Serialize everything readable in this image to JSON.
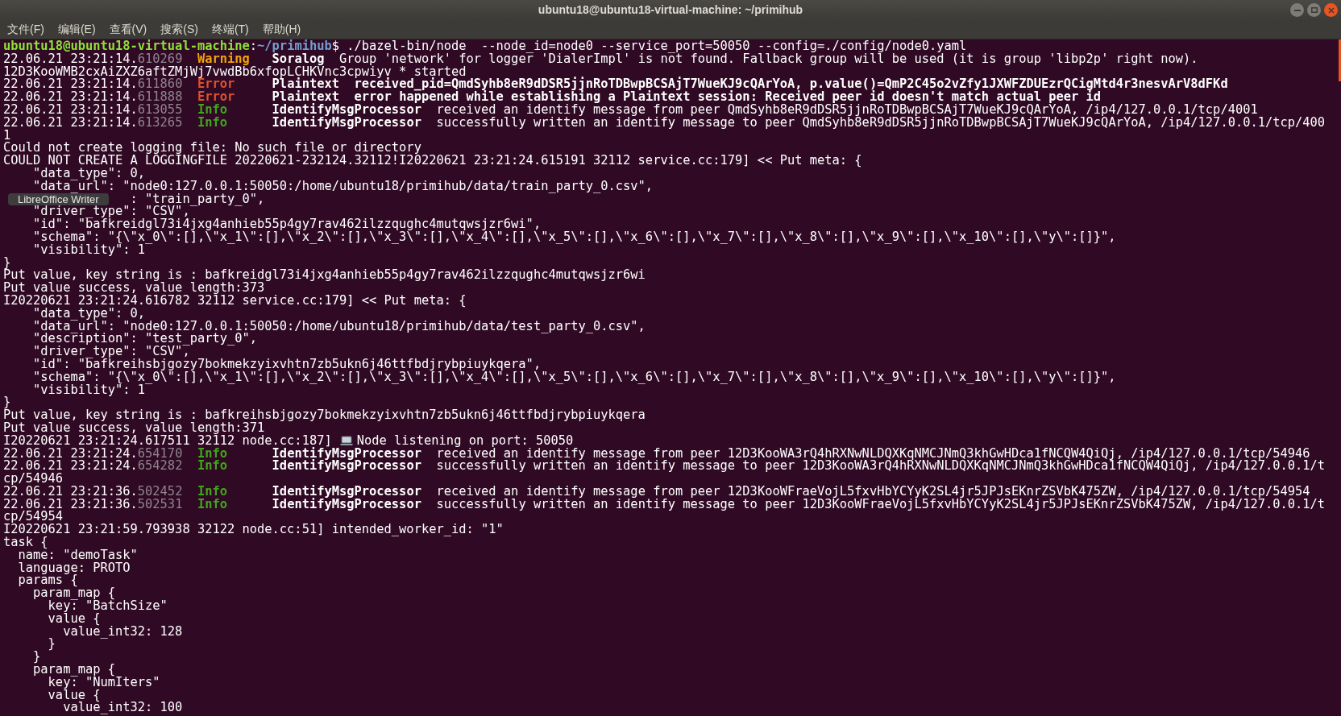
{
  "window": {
    "title": "ubuntu18@ubuntu18-virtual-machine: ~/primihub"
  },
  "menu": [
    "文件(F)",
    "编辑(E)",
    "查看(V)",
    "搜索(S)",
    "终端(T)",
    "帮助(H)"
  ],
  "tooltip": "LibreOffice Writer",
  "lines": [
    {
      "kind": "prompt",
      "user_host": "ubuntu18@ubuntu18-virtual-machine",
      "separator": ":",
      "path": "~/primihub",
      "command": "$ ./bazel-bin/node  --node_id=node0 --service_port=50050 --config=./config/node0.yaml"
    },
    {
      "kind": "log",
      "time": "22.06.21 23:21:14.",
      "micros": "610269",
      "level": "Warning",
      "color": "#f0a30a",
      "source": "Soralog",
      "message": "Group 'network' for logger 'DialerImpl' is not found. Fallback group will be used (it is group 'libp2p' right now).",
      "bold_message": false
    },
    {
      "kind": "plain",
      "text": "12D3KooWMB2cxAiZXZ6aftZMjWj7vwdBb6xfopLCHKVnc3cpwiyv * started"
    },
    {
      "kind": "log",
      "time": "22.06.21 23:21:14.",
      "micros": "611860",
      "level": "Error",
      "color": "#e0502a",
      "source": "Plaintext",
      "message": "received_pid=QmdSyhb8eR9dDSR5jjnRoTDBwpBCSAjT7WueKJ9cQArYoA, p.value()=QmP2C45o2vZfy1JXWFZDUEzrQCigMtd4r3nesvArV8dFKd",
      "bold_message": true
    },
    {
      "kind": "log",
      "time": "22.06.21 23:21:14.",
      "micros": "611888",
      "level": "Error",
      "color": "#e0502a",
      "source": "Plaintext",
      "message": "error happened while establishing a Plaintext session: Received peer id doesn't match actual peer id",
      "bold_message": true
    },
    {
      "kind": "log",
      "time": "22.06.21 23:21:14.",
      "micros": "613055",
      "level": "Info",
      "color": "#3fa61a",
      "source": "IdentifyMsgProcessor",
      "message": "received an identify message from peer QmdSyhb8eR9dDSR5jjnRoTDBwpBCSAjT7WueKJ9cQArYoA, /ip4/127.0.0.1/tcp/4001",
      "bold_message": false
    },
    {
      "kind": "log",
      "time": "22.06.21 23:21:14.",
      "micros": "613265",
      "level": "Info",
      "color": "#3fa61a",
      "source": "IdentifyMsgProcessor",
      "message": "successfully written an identify message to peer QmdSyhb8eR9dDSR5jjnRoTDBwpBCSAjT7WueKJ9cQArYoA, /ip4/127.0.0.1/tcp/400",
      "bold_message": false
    },
    {
      "kind": "plain",
      "text": "1"
    },
    {
      "kind": "plain",
      "text": "Could not create logging file: No such file or directory"
    },
    {
      "kind": "plain",
      "text": "COULD NOT CREATE A LOGGINGFILE 20220621-232124.32112!I20220621 23:21:24.615191 32112 service.cc:179] << Put meta: {"
    },
    {
      "kind": "plain",
      "text": "    \"data_type\": 0,"
    },
    {
      "kind": "plain",
      "text": "    \"data_url\": \"node0:127.0.0.1:50050:/home/ubuntu18/primihub/data/train_party_0.csv\","
    },
    {
      "kind": "covered",
      "text": ": \"train_party_0\","
    },
    {
      "kind": "plain",
      "text": "    \"driver_type\": \"CSV\","
    },
    {
      "kind": "plain",
      "text": "    \"id\": \"bafkreidgl73i4jxg4anhieb55p4gy7rav462ilzzqughc4mutqwsjzr6wi\","
    },
    {
      "kind": "plain",
      "text": "    \"schema\": \"{\\\"x_0\\\":[],\\\"x_1\\\":[],\\\"x_2\\\":[],\\\"x_3\\\":[],\\\"x_4\\\":[],\\\"x_5\\\":[],\\\"x_6\\\":[],\\\"x_7\\\":[],\\\"x_8\\\":[],\\\"x_9\\\":[],\\\"x_10\\\":[],\\\"y\\\":[]}\","
    },
    {
      "kind": "plain",
      "text": "    \"visibility\": 1"
    },
    {
      "kind": "plain",
      "text": "}"
    },
    {
      "kind": "plain",
      "text": "Put value, key string is : bafkreidgl73i4jxg4anhieb55p4gy7rav462ilzzqughc4mutqwsjzr6wi"
    },
    {
      "kind": "plain",
      "text": "Put value success, value length:373"
    },
    {
      "kind": "plain",
      "text": "I20220621 23:21:24.616782 32112 service.cc:179] << Put meta: {"
    },
    {
      "kind": "plain",
      "text": "    \"data_type\": 0,"
    },
    {
      "kind": "plain",
      "text": "    \"data_url\": \"node0:127.0.0.1:50050:/home/ubuntu18/primihub/data/test_party_0.csv\","
    },
    {
      "kind": "plain",
      "text": "    \"description\": \"test_party_0\","
    },
    {
      "kind": "plain",
      "text": "    \"driver_type\": \"CSV\","
    },
    {
      "kind": "plain",
      "text": "    \"id\": \"bafkreihsbjgozy7bokmekzyixvhtn7zb5ukn6j46ttfbdjrybpiuykqera\","
    },
    {
      "kind": "plain",
      "text": "    \"schema\": \"{\\\"x_0\\\":[],\\\"x_1\\\":[],\\\"x_2\\\":[],\\\"x_3\\\":[],\\\"x_4\\\":[],\\\"x_5\\\":[],\\\"x_6\\\":[],\\\"x_7\\\":[],\\\"x_8\\\":[],\\\"x_9\\\":[],\\\"x_10\\\":[],\\\"y\\\":[]}\","
    },
    {
      "kind": "plain",
      "text": "    \"visibility\": 1"
    },
    {
      "kind": "plain",
      "text": "}"
    },
    {
      "kind": "plain",
      "text": "Put value, key string is : bafkreihsbjgozy7bokmekzyixvhtn7zb5ukn6j46ttfbdjrybpiuykqera"
    },
    {
      "kind": "plain",
      "text": "Put value success, value length:371"
    },
    {
      "kind": "icon_line",
      "prefix": "I20220621 23:21:24.617511 32112 node.cc:187]",
      "text": "Node listening on port: 50050"
    },
    {
      "kind": "log",
      "time": "22.06.21 23:21:24.",
      "micros": "654170",
      "level": "Info",
      "color": "#3fa61a",
      "source": "IdentifyMsgProcessor",
      "message": "received an identify message from peer 12D3KooWA3rQ4hRXNwNLDQXKqNMCJNmQ3khGwHDca1fNCQW4QiQj, /ip4/127.0.0.1/tcp/54946",
      "bold_message": false
    },
    {
      "kind": "log",
      "time": "22.06.21 23:21:24.",
      "micros": "654282",
      "level": "Info",
      "color": "#3fa61a",
      "source": "IdentifyMsgProcessor",
      "message": "successfully written an identify message to peer 12D3KooWA3rQ4hRXNwNLDQXKqNMCJNmQ3khGwHDca1fNCQW4QiQj, /ip4/127.0.0.1/t",
      "bold_message": false
    },
    {
      "kind": "plain",
      "text": "cp/54946"
    },
    {
      "kind": "log",
      "time": "22.06.21 23:21:36.",
      "micros": "502452",
      "level": "Info",
      "color": "#3fa61a",
      "source": "IdentifyMsgProcessor",
      "message": "received an identify message from peer 12D3KooWFraeVojL5fxvHbYCYyK2SL4jr5JPJsEKnrZSVbK475ZW, /ip4/127.0.0.1/tcp/54954",
      "bold_message": false
    },
    {
      "kind": "log",
      "time": "22.06.21 23:21:36.",
      "micros": "502531",
      "level": "Info",
      "color": "#3fa61a",
      "source": "IdentifyMsgProcessor",
      "message": "successfully written an identify message to peer 12D3KooWFraeVojL5fxvHbYCYyK2SL4jr5JPJsEKnrZSVbK475ZW, /ip4/127.0.0.1/t",
      "bold_message": false
    },
    {
      "kind": "plain",
      "text": "cp/54954"
    },
    {
      "kind": "plain",
      "text": "I20220621 23:21:59.793938 32122 node.cc:51] intended_worker_id: \"1\""
    },
    {
      "kind": "plain",
      "text": "task {"
    },
    {
      "kind": "plain",
      "text": "  name: \"demoTask\""
    },
    {
      "kind": "plain",
      "text": "  language: PROTO"
    },
    {
      "kind": "plain",
      "text": "  params {"
    },
    {
      "kind": "plain",
      "text": "    param_map {"
    },
    {
      "kind": "plain",
      "text": "      key: \"BatchSize\""
    },
    {
      "kind": "plain",
      "text": "      value {"
    },
    {
      "kind": "plain",
      "text": "        value_int32: 128"
    },
    {
      "kind": "plain",
      "text": "      }"
    },
    {
      "kind": "plain",
      "text": "    }"
    },
    {
      "kind": "plain",
      "text": "    param_map {"
    },
    {
      "kind": "plain",
      "text": "      key: \"NumIters\""
    },
    {
      "kind": "plain",
      "text": "      value {"
    },
    {
      "kind": "plain",
      "text": "        value_int32: 100"
    }
  ]
}
